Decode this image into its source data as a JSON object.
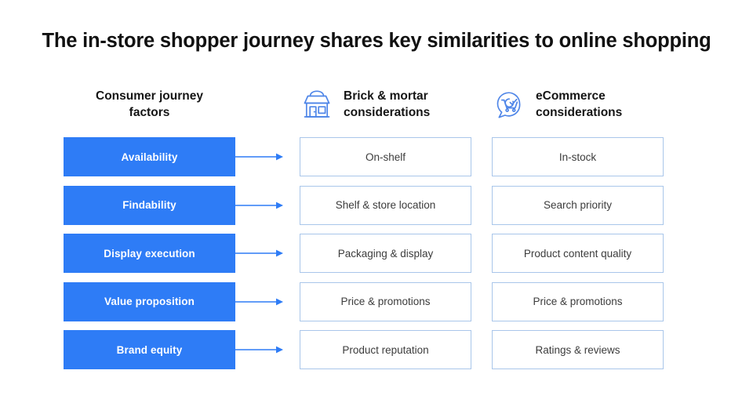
{
  "title": "The in-store shopper journey shares key similarities to online shopping",
  "columns": {
    "factors": {
      "line1": "Consumer journey",
      "line2": "factors"
    },
    "brick": {
      "line1": "Brick & mortar",
      "line2": "considerations",
      "icon": "storefront-icon"
    },
    "ecommerce": {
      "line1": "eCommerce",
      "line2": "considerations",
      "icon": "cart-speech-bubble-icon"
    }
  },
  "colors": {
    "accent_blue": "#2e7cf6",
    "cell_border": "#a9c6ea",
    "arrow": "#2e7cf6",
    "title_text": "#111111",
    "cell_text": "#3c3c3c"
  },
  "rows": [
    {
      "factor": "Availability",
      "brick": "On-shelf",
      "ecommerce": "In-stock"
    },
    {
      "factor": "Findability",
      "brick": "Shelf & store location",
      "ecommerce": "Search priority"
    },
    {
      "factor": "Display execution",
      "brick": "Packaging & display",
      "ecommerce": "Product content quality"
    },
    {
      "factor": "Value proposition",
      "brick": "Price & promotions",
      "ecommerce": "Price & promotions"
    },
    {
      "factor": "Brand equity",
      "brick": "Product reputation",
      "ecommerce": "Ratings & reviews"
    }
  ]
}
